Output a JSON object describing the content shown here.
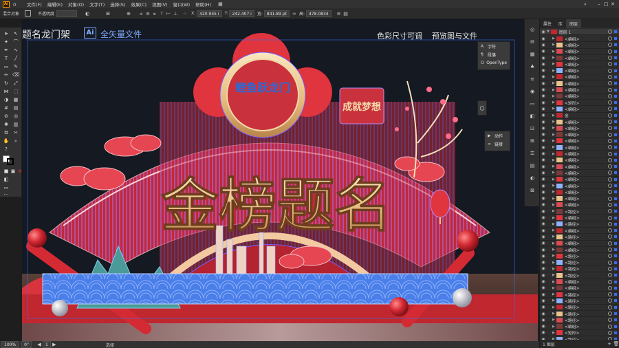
{
  "menubar": {
    "logo": "Ai",
    "items": [
      "文件(F)",
      "编辑(E)",
      "对象(O)",
      "文字(T)",
      "选择(S)",
      "效果(C)",
      "视图(V)",
      "窗口(W)",
      "帮助(H)"
    ],
    "layout_icon": "▦"
  },
  "control_bar": {
    "selection_label": "混合对象",
    "opacity_label": "不透明度",
    "x_value": "420.945 i",
    "y_value": "242.407 i",
    "w_value": "841.89 pt",
    "h_value": "478.0834"
  },
  "canvas": {
    "title_text": "题名龙门架",
    "ai_badge": "Ai",
    "subtitle": "全矢量文件",
    "right_caption_1": "色彩尺寸可调",
    "right_caption_2": "预览图与文件",
    "headline": "金榜题名",
    "plaque_text": "鲤鱼跃龙门",
    "seal_text": "成就梦想"
  },
  "float_panel_type": {
    "items": [
      {
        "glyph": "A",
        "label": "字符"
      },
      {
        "glyph": "¶",
        "label": "段落"
      },
      {
        "glyph": "O",
        "label": "OpenType"
      }
    ]
  },
  "float_panel_actions": {
    "items": [
      {
        "glyph": "▶",
        "label": "动作"
      },
      {
        "glyph": "∞",
        "label": "链接"
      }
    ]
  },
  "layers_panel": {
    "tabs": [
      "属性",
      "库",
      "图层"
    ],
    "top_layer": "图层 1",
    "rows": [
      "<编组>",
      "<编组>",
      "<编组>",
      "<编组>",
      "<编组>",
      "<编组>",
      "<编组>",
      "<编组>",
      "<编组>",
      "<编组>",
      "<矩形>",
      "<编组>",
      "金",
      "<编组>",
      "<编组>",
      "<编组>",
      "<编组>",
      "<编组>",
      "<编组>",
      "<编组>",
      "<编组>",
      "<编组>",
      "<编组>",
      "<编组>",
      "<编组>",
      "<编组>",
      "<编组>",
      "<路径>",
      "<编组>",
      "<路径>",
      "<编组>",
      "<路径>",
      "<编组>",
      "<编组>",
      "<路径>",
      "<路径>",
      "<路径>",
      "<路径>",
      "<编组>",
      "<编组>",
      "<路径>",
      "<路径>",
      "<路径>",
      "<路径>",
      "<路径>",
      "<编组>",
      "<矩形>",
      "<路径>"
    ],
    "footer_label": "1 图层"
  },
  "status_bar": {
    "zoom": "100%",
    "rotation": "0°",
    "artboard": "1",
    "tool_name": "选择"
  },
  "colors": {
    "accent_red": "#d42a34",
    "gold": "#e8c48a",
    "blue_selection": "#3a6df0",
    "cyan_wave": "#4a7ee8"
  }
}
